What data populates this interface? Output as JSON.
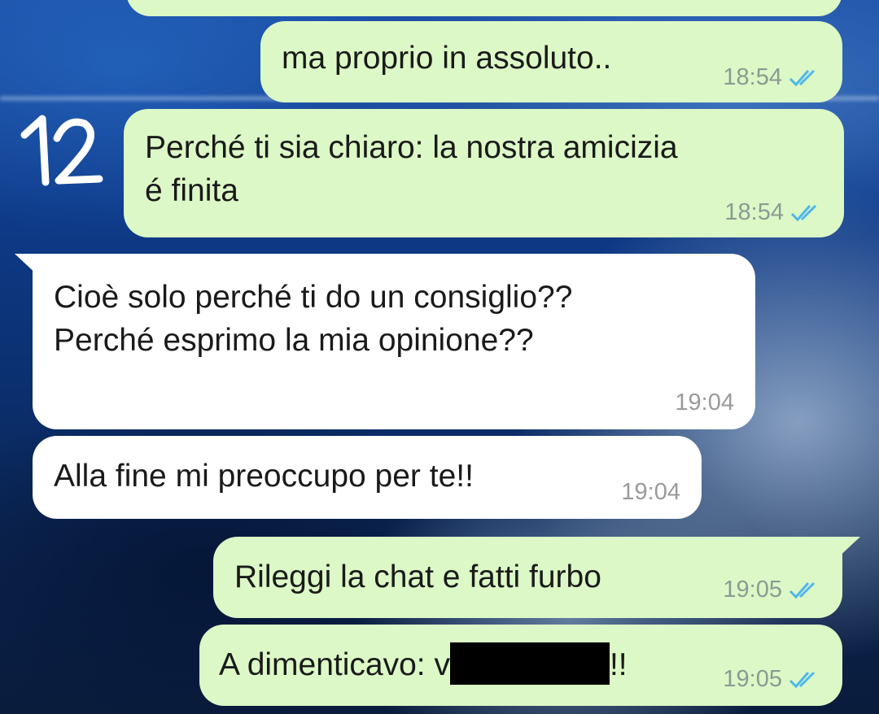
{
  "chat": {
    "annotation_number": "12",
    "messages": [
      {
        "direction": "outgoing",
        "text": "",
        "time": "",
        "read": true
      },
      {
        "direction": "outgoing",
        "text": "ma proprio in assoluto..",
        "time": "18:54",
        "read": true
      },
      {
        "direction": "outgoing",
        "text": "Perché ti sia chiaro: la nostra amicizia\né finita",
        "time": "18:54",
        "read": true
      },
      {
        "direction": "incoming",
        "text": "Cioè solo perché ti do un consiglio??\nPerché esprimo la mia opinione??",
        "time": "19:04"
      },
      {
        "direction": "incoming",
        "text": "Alla fine mi preoccupo per te!!",
        "time": "19:04"
      },
      {
        "direction": "outgoing",
        "text": "Rileggi la chat e fatti furbo",
        "time": "19:05",
        "read": true
      },
      {
        "direction": "outgoing",
        "text_before": "A dimenticavo: v",
        "text_redacted": "[redacted]",
        "text_after": "!!",
        "time": "19:05",
        "read": true
      }
    ]
  },
  "colors": {
    "outgoing_bubble": "#dcf8c6",
    "incoming_bubble": "#ffffff",
    "read_tick": "#4fb6ec",
    "timestamp": "#8c9a93"
  },
  "icons": {
    "read_receipt": "double-check-icon"
  }
}
